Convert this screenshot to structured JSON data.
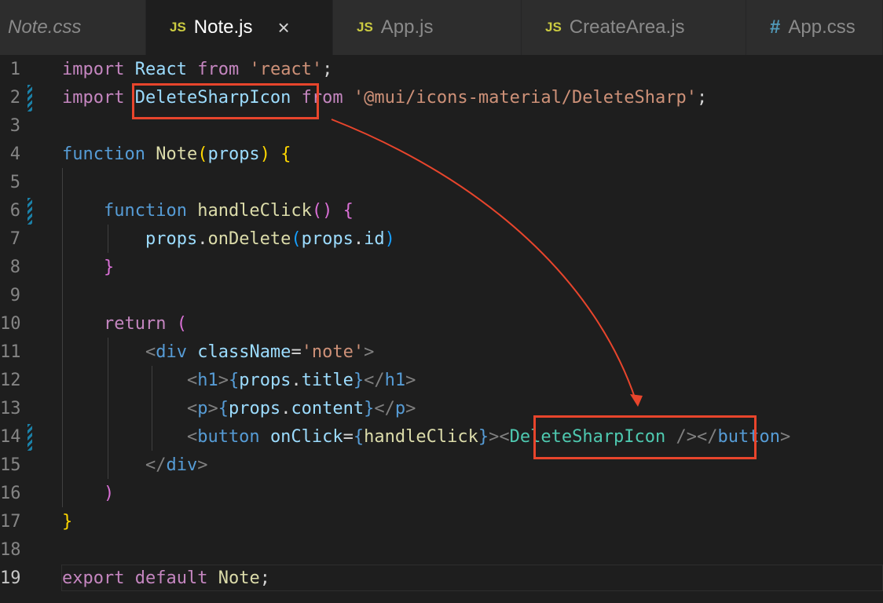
{
  "tabs": [
    {
      "label": "Note.css",
      "icon": "",
      "active": false,
      "italic": true
    },
    {
      "label": "Note.js",
      "icon": "JS",
      "active": true,
      "italic": false,
      "close": "×"
    },
    {
      "label": "App.js",
      "icon": "JS",
      "active": false,
      "italic": false
    },
    {
      "label": "CreateArea.js",
      "icon": "JS",
      "active": false,
      "italic": false
    },
    {
      "label": "App.css",
      "icon": "#",
      "active": false,
      "italic": false
    }
  ],
  "editor": {
    "current_line": 19,
    "modified_lines": [
      2,
      6,
      14
    ],
    "lines": [
      {
        "n": "1",
        "tokens": [
          [
            "kw",
            "import"
          ],
          [
            "pl",
            " "
          ],
          [
            "vb",
            "React"
          ],
          [
            "pl",
            " "
          ],
          [
            "kw",
            "from"
          ],
          [
            "pl",
            " "
          ],
          [
            "st",
            "'react'"
          ],
          [
            "pl",
            ";"
          ]
        ]
      },
      {
        "n": "2",
        "tokens": [
          [
            "kw",
            "import"
          ],
          [
            "pl",
            " "
          ],
          [
            "vb",
            "DeleteSharpIcon"
          ],
          [
            "pl",
            " "
          ],
          [
            "kw",
            "from"
          ],
          [
            "pl",
            " "
          ],
          [
            "st",
            "'@mui/icons-material/DeleteSharp'"
          ],
          [
            "pl",
            ";"
          ]
        ]
      },
      {
        "n": "3",
        "tokens": []
      },
      {
        "n": "4",
        "tokens": [
          [
            "tg",
            "function"
          ],
          [
            "pl",
            " "
          ],
          [
            "fn",
            "Note"
          ],
          [
            "br1",
            "("
          ],
          [
            "vb",
            "props"
          ],
          [
            "br1",
            ")"
          ],
          [
            "pl",
            " "
          ],
          [
            "br1",
            "{"
          ]
        ]
      },
      {
        "n": "5",
        "tokens": []
      },
      {
        "n": "6",
        "tokens": [
          [
            "pl",
            "    "
          ],
          [
            "tg",
            "function"
          ],
          [
            "pl",
            " "
          ],
          [
            "fn",
            "handleClick"
          ],
          [
            "br2",
            "()"
          ],
          [
            "pl",
            " "
          ],
          [
            "br2",
            "{"
          ]
        ]
      },
      {
        "n": "7",
        "tokens": [
          [
            "pl",
            "        "
          ],
          [
            "vb",
            "props"
          ],
          [
            "pl",
            "."
          ],
          [
            "fn",
            "onDelete"
          ],
          [
            "br3",
            "("
          ],
          [
            "vb",
            "props"
          ],
          [
            "pl",
            "."
          ],
          [
            "vb",
            "id"
          ],
          [
            "br3",
            ")"
          ]
        ]
      },
      {
        "n": "8",
        "tokens": [
          [
            "pl",
            "    "
          ],
          [
            "br2",
            "}"
          ]
        ]
      },
      {
        "n": "9",
        "tokens": []
      },
      {
        "n": "10",
        "tokens": [
          [
            "pl",
            "    "
          ],
          [
            "kw",
            "return"
          ],
          [
            "pl",
            " "
          ],
          [
            "br2",
            "("
          ]
        ]
      },
      {
        "n": "11",
        "tokens": [
          [
            "pl",
            "        "
          ],
          [
            "tagp",
            "<"
          ],
          [
            "tg",
            "div"
          ],
          [
            "pl",
            " "
          ],
          [
            "vb",
            "className"
          ],
          [
            "pl",
            "="
          ],
          [
            "st",
            "'note'"
          ],
          [
            "tagp",
            ">"
          ]
        ]
      },
      {
        "n": "12",
        "tokens": [
          [
            "pl",
            "            "
          ],
          [
            "tagp",
            "<"
          ],
          [
            "tg",
            "h1"
          ],
          [
            "tagp",
            ">"
          ],
          [
            "tg",
            "{"
          ],
          [
            "vb",
            "props"
          ],
          [
            "pl",
            "."
          ],
          [
            "vb",
            "title"
          ],
          [
            "tg",
            "}"
          ],
          [
            "tagp",
            "</"
          ],
          [
            "tg",
            "h1"
          ],
          [
            "tagp",
            ">"
          ]
        ]
      },
      {
        "n": "13",
        "tokens": [
          [
            "pl",
            "            "
          ],
          [
            "tagp",
            "<"
          ],
          [
            "tg",
            "p"
          ],
          [
            "tagp",
            ">"
          ],
          [
            "tg",
            "{"
          ],
          [
            "vb",
            "props"
          ],
          [
            "pl",
            "."
          ],
          [
            "vb",
            "content"
          ],
          [
            "tg",
            "}"
          ],
          [
            "tagp",
            "</"
          ],
          [
            "tg",
            "p"
          ],
          [
            "tagp",
            ">"
          ]
        ]
      },
      {
        "n": "14",
        "tokens": [
          [
            "pl",
            "            "
          ],
          [
            "tagp",
            "<"
          ],
          [
            "tg",
            "button"
          ],
          [
            "pl",
            " "
          ],
          [
            "vb",
            "onClick"
          ],
          [
            "pl",
            "="
          ],
          [
            "tg",
            "{"
          ],
          [
            "fn",
            "handleClick"
          ],
          [
            "tg",
            "}"
          ],
          [
            "tagp",
            "><"
          ],
          [
            "cmp",
            "DeleteSharpIcon"
          ],
          [
            "pl",
            " "
          ],
          [
            "tagp",
            "/></"
          ],
          [
            "tg",
            "button"
          ],
          [
            "tagp",
            ">"
          ]
        ]
      },
      {
        "n": "15",
        "tokens": [
          [
            "pl",
            "        "
          ],
          [
            "tagp",
            "</"
          ],
          [
            "tg",
            "div"
          ],
          [
            "tagp",
            ">"
          ]
        ]
      },
      {
        "n": "16",
        "tokens": [
          [
            "pl",
            "    "
          ],
          [
            "br2",
            ")"
          ]
        ]
      },
      {
        "n": "17",
        "tokens": [
          [
            "br1",
            "}"
          ]
        ]
      },
      {
        "n": "18",
        "tokens": []
      },
      {
        "n": "19",
        "tokens": [
          [
            "kw",
            "export"
          ],
          [
            "pl",
            " "
          ],
          [
            "kw",
            "default"
          ],
          [
            "pl",
            " "
          ],
          [
            "fn",
            "Note"
          ],
          [
            "pl",
            ";"
          ]
        ]
      }
    ]
  },
  "annotation": {
    "box_color": "#e8452c",
    "arrow_color": "#e8452c"
  }
}
